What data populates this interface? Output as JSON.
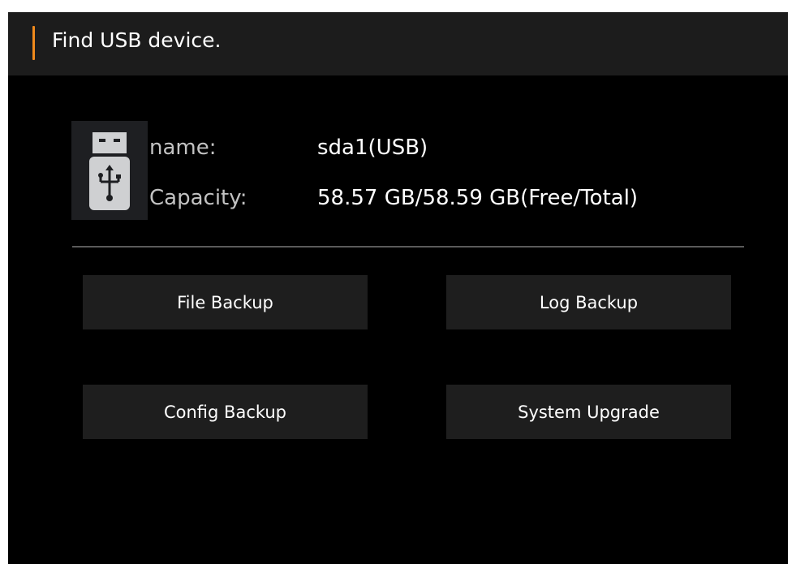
{
  "dialog": {
    "title": "Find USB device."
  },
  "device": {
    "icon": "usb-drive-icon",
    "name_label": "name:",
    "name_value": "sda1(USB)",
    "capacity_label": "Capacity:",
    "capacity_value": "58.57 GB/58.59 GB(Free/Total)"
  },
  "actions": {
    "file_backup": "File Backup",
    "log_backup": "Log Backup",
    "config_backup": "Config Backup",
    "system_upgrade": "System Upgrade"
  },
  "colors": {
    "accent": "#f08a1c",
    "background": "#000000",
    "titlebar": "#1c1c1c",
    "button": "#1e1e1e"
  }
}
